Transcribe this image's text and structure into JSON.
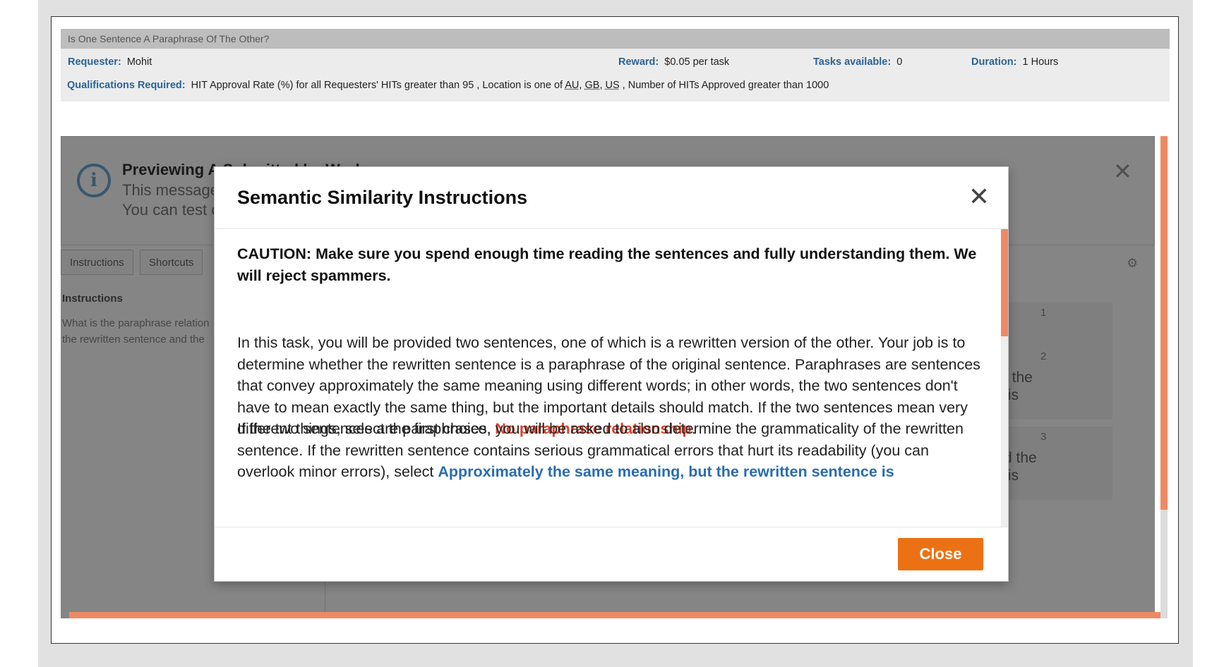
{
  "hit": {
    "title": "Is One Sentence A Paraphrase Of The Other?",
    "requester_label": "Requester:",
    "requester": "Mohit",
    "reward_label": "Reward:",
    "reward": "$0.05 per task",
    "tasks_label": "Tasks available:",
    "tasks": "0",
    "duration_label": "Duration:",
    "duration": "1 Hours",
    "qual_label": "Qualifications Required:",
    "qual_text_1": "HIT Approval Rate (%) for all Requesters' HITs greater than 95 , Location is one of ",
    "loc_au": "AU",
    "loc_gb": "GB",
    "loc_us": "US",
    "qual_text_2": " , Number of HITs Approved greater than 1000"
  },
  "background": {
    "alert_title": "Previewing A         Submitted by Work",
    "alert_line_1": "This message",
    "alert_line_2": "You can test c",
    "tab_instructions": "Instructions",
    "tab_shortcuts": "Shortcuts",
    "instructions_heading": "Instructions",
    "instructions_text": "What is the paraphrase relation the rewritten sentence and the",
    "num_1": "1",
    "num_2": "2",
    "num_3": "3",
    "frag_2": "t the\n is",
    "frag_3": "d the\n is"
  },
  "modal": {
    "title": "Semantic Similarity Instructions",
    "caution": "CAUTION: Make sure you spend enough time reading the sentences and fully understanding them. We will reject spammers.",
    "para1_text": "In this task, you will be provided two sentences, one of which is a rewritten version of the other. Your job is to determine whether the rewritten sentence is a paraphrase of the original sentence. Paraphrases are sentences that convey approximately the same meaning using different words; in other words, the two sentences don't have to mean exactly the same thing, but the important details should match. If the two sentences mean very different things, select the first choice, ",
    "para1_link": "No paraphrase relationship",
    "para1_end": ".",
    "para2_text": "If the two sentences are paraphrases, you will be asked to also determine the grammaticality of the rewritten sentence. If the rewritten sentence contains serious grammatical errors that hurt its readability (you can overlook minor errors), select ",
    "para2_link": "Approximately the same meaning, but the rewritten sentence is",
    "close_button": "Close"
  },
  "colors": {
    "accent_orange": "#ec7114",
    "label_blue": "#2a6496",
    "link_red": "#d9432c",
    "link_blue": "#2a6cb0"
  }
}
